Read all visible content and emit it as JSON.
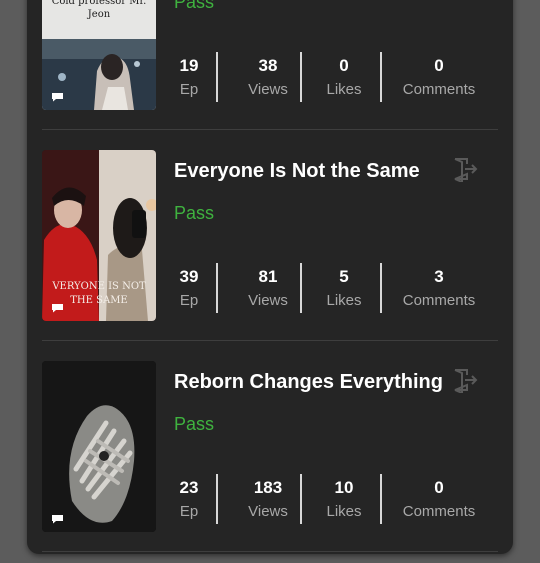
{
  "stories": [
    {
      "title": "",
      "status": "Pass",
      "cover_text": "Cold professor Mr. Jeon",
      "stats": [
        {
          "value": "19",
          "label": "Ep"
        },
        {
          "value": "38",
          "label": "Views"
        },
        {
          "value": "0",
          "label": "Likes"
        },
        {
          "value": "0",
          "label": "Comments"
        }
      ]
    },
    {
      "title": "Everyone Is Not the Same",
      "status": "Pass",
      "cover_text": "VERYONE IS NOT THE SAME",
      "stats": [
        {
          "value": "39",
          "label": "Ep"
        },
        {
          "value": "81",
          "label": "Views"
        },
        {
          "value": "5",
          "label": "Likes"
        },
        {
          "value": "3",
          "label": "Comments"
        }
      ]
    },
    {
      "title": "Reborn Changes Everything",
      "status": "Pass",
      "cover_text": "",
      "stats": [
        {
          "value": "23",
          "label": "Ep"
        },
        {
          "value": "183",
          "label": "Views"
        },
        {
          "value": "10",
          "label": "Likes"
        },
        {
          "value": "0",
          "label": "Comments"
        }
      ]
    }
  ],
  "colors": {
    "status": "#3fb23f",
    "panel": "#252525",
    "background": "#5c5c5c"
  },
  "icons": [
    "chat-icon",
    "exit-icon"
  ]
}
